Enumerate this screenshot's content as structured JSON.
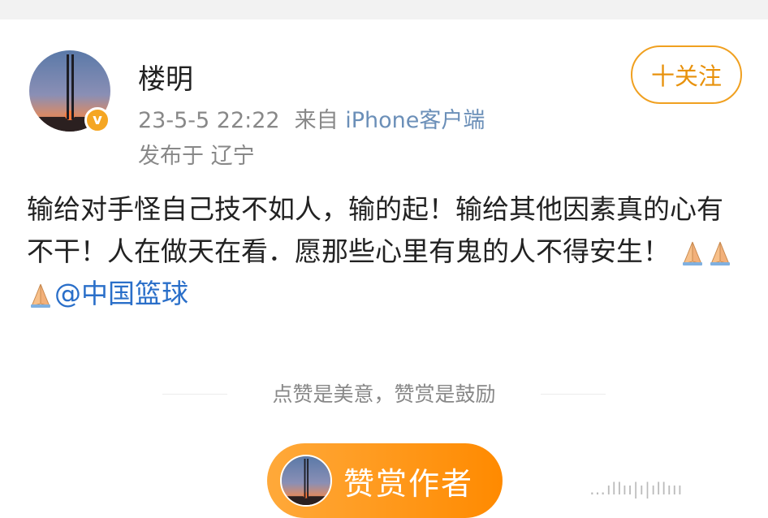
{
  "post": {
    "username": "楼明",
    "timestamp": "23-5-5 22:22",
    "source_prefix": "来自",
    "source_client": "iPhone客户端",
    "location": "发布于 辽宁",
    "verified_badge": "v",
    "follow_label": "十关注",
    "content_text": "输给对手怪自己技不如人，输的起！输给其他因素真的心有不干！人在做天在看．愿那些心里有鬼的人不得安生！",
    "emoji": [
      "folded-hands",
      "folded-hands",
      "folded-hands"
    ],
    "mention": "@中国篮球"
  },
  "reward": {
    "tip": "点赞是美意，赞赏是鼓励",
    "button_label": "赞赏作者"
  },
  "watermark": "…ıllıı|ı|ıllııı",
  "colors": {
    "accent_orange": "#ff8a00",
    "follow_border": "#f0a020",
    "link_blue": "#2a6fc9",
    "meta_gray": "#888888",
    "verified_gold": "#f5a623"
  }
}
